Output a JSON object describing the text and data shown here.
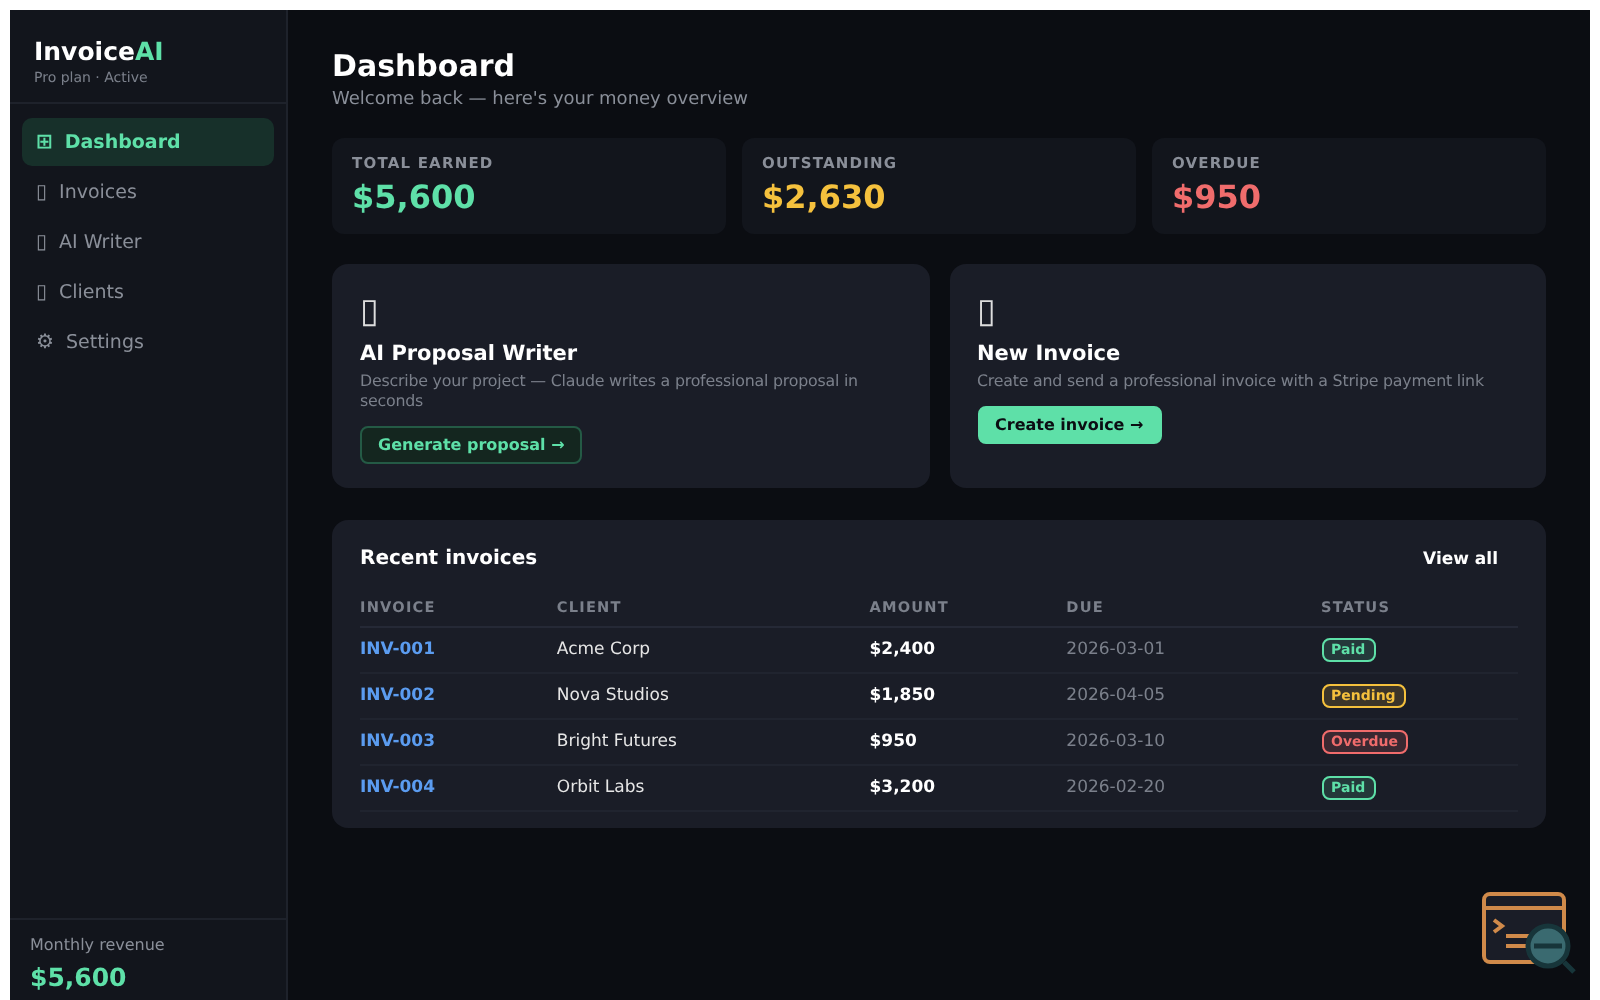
{
  "brand": {
    "name": "Invoice",
    "accent": "AI",
    "plan": "Pro plan · Active"
  },
  "nav": [
    {
      "icon": "⊞",
      "label": "Dashboard",
      "selected": true
    },
    {
      "icon": "▯",
      "label": "Invoices",
      "selected": false
    },
    {
      "icon": "▯",
      "label": "AI Writer",
      "selected": false
    },
    {
      "icon": "▯",
      "label": "Clients",
      "selected": false
    },
    {
      "icon": "⚙",
      "label": "Settings",
      "selected": false
    }
  ],
  "sidebar_footer": {
    "label": "Monthly revenue",
    "value": "$5,600"
  },
  "header": {
    "title": "Dashboard",
    "subtitle": "Welcome back — here's your money overview"
  },
  "stats": [
    {
      "label": "TOTAL EARNED",
      "value": "$5,600",
      "color": "#5ee0a8"
    },
    {
      "label": "OUTSTANDING",
      "value": "$2,630",
      "color": "#f5c13d"
    },
    {
      "label": "OVERDUE",
      "value": "$950",
      "color": "#f06c6c"
    }
  ],
  "actions": [
    {
      "icon": "▯",
      "title": "AI Proposal Writer",
      "text": "Describe your project — Claude writes a professional proposal in seconds",
      "button": "Generate proposal →",
      "kind": "outline"
    },
    {
      "icon": "▯",
      "title": "New Invoice",
      "text": "Create and send a professional invoice with a Stripe payment link",
      "button": "Create invoice →",
      "kind": "solid"
    }
  ],
  "recent": {
    "title": "Recent invoices",
    "link": "View all",
    "columns": [
      "INVOICE",
      "CLIENT",
      "AMOUNT",
      "DUE",
      "STATUS"
    ],
    "rows": [
      {
        "id": "INV-001",
        "client": "Acme Corp",
        "amount": "$2,400",
        "due": "2026-03-01",
        "status": "Paid",
        "color": "#5ee0a8"
      },
      {
        "id": "INV-002",
        "client": "Nova Studios",
        "amount": "$1,850",
        "due": "2026-04-05",
        "status": "Pending",
        "color": "#f5c13d"
      },
      {
        "id": "INV-003",
        "client": "Bright Futures",
        "amount": "$950",
        "due": "2026-03-10",
        "status": "Overdue",
        "color": "#f06c6c"
      },
      {
        "id": "INV-004",
        "client": "Orbit Labs",
        "amount": "$3,200",
        "due": "2026-02-20",
        "status": "Paid",
        "color": "#5ee0a8"
      }
    ]
  }
}
